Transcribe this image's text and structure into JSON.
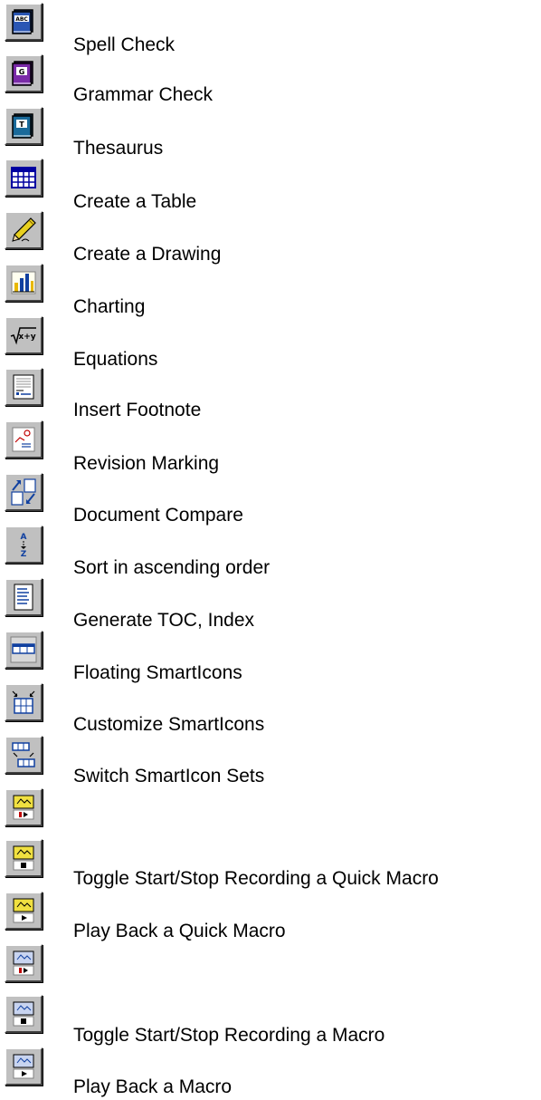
{
  "items": [
    {
      "label": "Spell Check",
      "icon": "spell-check-icon"
    },
    {
      "label": "Grammar Check",
      "icon": "grammar-check-icon"
    },
    {
      "label": "Thesaurus",
      "icon": "thesaurus-icon"
    },
    {
      "label": "Create a Table",
      "icon": "table-icon"
    },
    {
      "label": "Create a Drawing",
      "icon": "drawing-pen-icon"
    },
    {
      "label": "Charting",
      "icon": "chart-icon"
    },
    {
      "label": "Equations",
      "icon": "equation-icon"
    },
    {
      "label": "Insert Footnote",
      "icon": "footnote-icon"
    },
    {
      "label": "Revision Marking",
      "icon": "revision-marking-icon"
    },
    {
      "label": "Document Compare",
      "icon": "document-compare-icon"
    },
    {
      "label": "Sort in ascending order",
      "icon": "sort-ascending-icon"
    },
    {
      "label": "Generate TOC, Index",
      "icon": "toc-index-icon"
    },
    {
      "label": "Floating SmartIcons",
      "icon": "floating-smarticons-icon"
    },
    {
      "label": "Customize SmartIcons",
      "icon": "customize-smarticons-icon"
    },
    {
      "label": "Switch SmartIcon Sets",
      "icon": "switch-smarticon-sets-icon"
    },
    {
      "label": "",
      "icon": "quick-macro-record-icon"
    },
    {
      "label": "Toggle Start/Stop Recording a Quick Macro",
      "icon": "quick-macro-stop-icon"
    },
    {
      "label": "Play Back a Quick Macro",
      "icon": "quick-macro-play-icon"
    },
    {
      "label": "",
      "icon": "macro-record-icon"
    },
    {
      "label": "Toggle Start/Stop Recording a Macro",
      "icon": "macro-stop-icon"
    },
    {
      "label": "Play Back a Macro",
      "icon": "macro-play-icon"
    }
  ]
}
